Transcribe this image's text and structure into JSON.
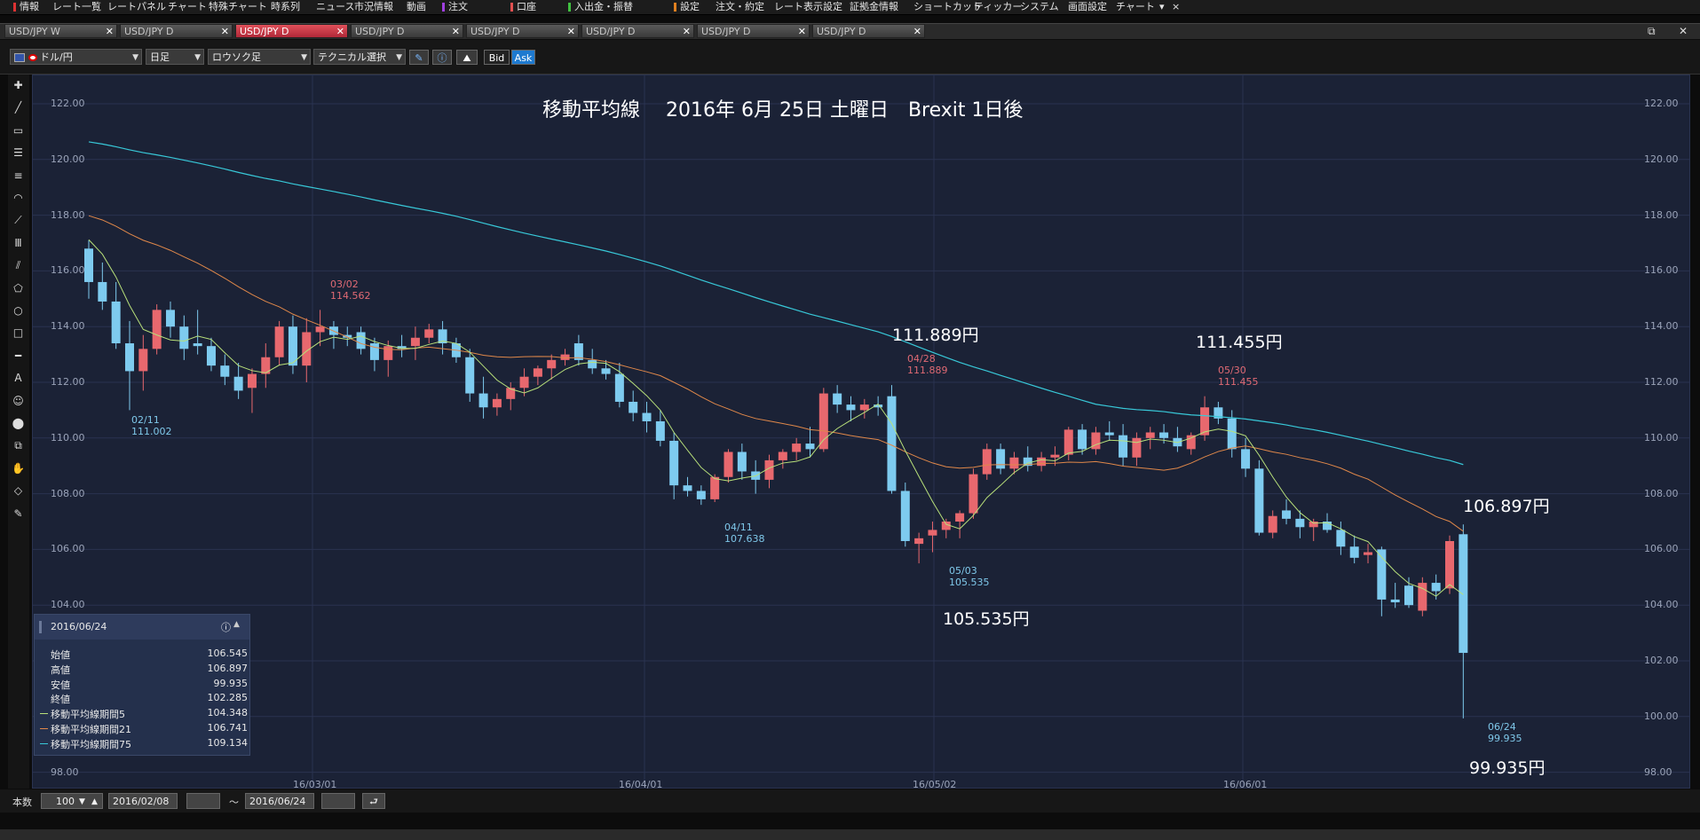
{
  "menubar": {
    "items": [
      {
        "label": "情報",
        "marker": "#d33"
      },
      {
        "label": "レート一覧",
        "marker": ""
      },
      {
        "label": "レートパネル",
        "marker": ""
      },
      {
        "label": "チャート",
        "marker": ""
      },
      {
        "label": "特殊チャート",
        "marker": ""
      },
      {
        "label": "時系列",
        "marker": ""
      },
      {
        "label": "ニュース",
        "marker": ""
      },
      {
        "label": "市況情報",
        "marker": ""
      },
      {
        "label": "動画",
        "marker": ""
      },
      {
        "label": "注文",
        "marker": "#a040e0"
      },
      {
        "label": "口座",
        "marker": "#e05050"
      },
      {
        "label": "入出金・振替",
        "marker": "#40c040"
      },
      {
        "label": "設定",
        "marker": "#e08020"
      },
      {
        "label": "注文・約定",
        "marker": ""
      },
      {
        "label": "レート表示設定",
        "marker": ""
      },
      {
        "label": "証拠金情報",
        "marker": ""
      },
      {
        "label": "ショートカット",
        "marker": ""
      },
      {
        "label": "ティッカー",
        "marker": ""
      },
      {
        "label": "システム",
        "marker": ""
      },
      {
        "label": "画面設定",
        "marker": ""
      },
      {
        "label": "チャート",
        "marker": ""
      }
    ],
    "overflow_arrow": "▾",
    "close": "×"
  },
  "tabs": [
    {
      "label": "USD/JPY W",
      "active": false
    },
    {
      "label": "USD/JPY D",
      "active": false
    },
    {
      "label": "USD/JPY D",
      "active": true
    },
    {
      "label": "USD/JPY D",
      "active": false
    },
    {
      "label": "USD/JPY D",
      "active": false
    },
    {
      "label": "USD/JPY D",
      "active": false
    },
    {
      "label": "USD/JPY D",
      "active": false
    },
    {
      "label": "USD/JPY D",
      "active": false
    }
  ],
  "toolbar": {
    "currency": "ドル/円",
    "period": "日足",
    "chart_type": "ロウソク足",
    "technical": "テクニカル選択",
    "bid": "Bid",
    "ask": "Ask"
  },
  "left_tools": [
    "crosshair-icon",
    "line-icon",
    "ruler-icon",
    "hline-icon",
    "multi-hline-icon",
    "fan-icon",
    "gann-icon",
    "vlines-icon",
    "pitchfork-icon",
    "pentagon-icon",
    "circle-icon",
    "rect-icon",
    "hline-bold-icon",
    "text-icon",
    "icon-tool-icon",
    "paint-icon",
    "copy-icon",
    "hand-icon",
    "eraser-icon",
    "pen-icon"
  ],
  "chart": {
    "title": "移動平均線　 2016年 6月 25日 土曜日　Brexit 1日後",
    "y_ticks": [
      "122.00",
      "120.00",
      "118.00",
      "116.00",
      "114.00",
      "112.00",
      "110.00",
      "108.00",
      "106.00",
      "104.00",
      "102.00",
      "100.00",
      "98.00"
    ],
    "x_ticks": [
      "16/03/01",
      "16/04/01",
      "16/05/02",
      "16/06/01"
    ],
    "big_annotations": [
      "111.889円",
      "111.455円",
      "106.897円",
      "105.535円",
      "99.935円"
    ],
    "marks": [
      {
        "date": "03/02",
        "value": "114.562",
        "color": "red"
      },
      {
        "date": "02/11",
        "value": "111.002",
        "color": "blue"
      },
      {
        "date": "04/28",
        "value": "111.889",
        "color": "red"
      },
      {
        "date": "04/11",
        "value": "107.638",
        "color": "blue"
      },
      {
        "date": "05/03",
        "value": "105.535",
        "color": "blue"
      },
      {
        "date": "05/30",
        "value": "111.455",
        "color": "red"
      },
      {
        "date": "06/24",
        "value": "99.935",
        "color": "blue"
      }
    ],
    "colors": {
      "bg": "#1b2236",
      "up": "#e8686e",
      "down": "#7ecbef",
      "ma5": "#b8e07a",
      "ma21": "#e0884a",
      "ma75": "#38c8d8",
      "grid": "#2a3350"
    }
  },
  "info_panel": {
    "date": "2016/06/24",
    "rows": [
      {
        "label": "始値",
        "value": "106.545",
        "swatch": ""
      },
      {
        "label": "高値",
        "value": "106.897",
        "swatch": ""
      },
      {
        "label": "安値",
        "value": "99.935",
        "swatch": ""
      },
      {
        "label": "終値",
        "value": "102.285",
        "swatch": ""
      },
      {
        "label": "移動平均線期間5",
        "value": "104.348",
        "swatch": "#b8e07a"
      },
      {
        "label": "移動平均線期間21",
        "value": "106.741",
        "swatch": "#e0884a"
      },
      {
        "label": "移動平均線期間75",
        "value": "109.134",
        "swatch": "#38c8d8"
      }
    ]
  },
  "bottom": {
    "count_label": "本数",
    "count_value": "100",
    "from_date": "2016/02/08",
    "tilde": "～",
    "to_date": "2016/06/24"
  },
  "chart_data": {
    "type": "candlestick",
    "title": "移動平均線 2016年 6月 25日 土曜日 Brexit 1日後",
    "ylim": [
      98,
      122
    ],
    "x_ticks": [
      "16/03/01",
      "16/04/01",
      "16/05/02",
      "16/06/01"
    ],
    "series_names": [
      "移動平均線期間5",
      "移動平均線期間21",
      "移動平均線期間75"
    ],
    "ohlc": [
      [
        116.8,
        117.1,
        115.0,
        115.6
      ],
      [
        115.6,
        116.3,
        114.6,
        114.9
      ],
      [
        114.9,
        115.6,
        113.2,
        113.4
      ],
      [
        113.4,
        114.2,
        111.0,
        112.4
      ],
      [
        112.4,
        113.7,
        111.7,
        113.2
      ],
      [
        113.2,
        114.8,
        113.0,
        114.6
      ],
      [
        114.6,
        114.9,
        113.6,
        114.0
      ],
      [
        114.0,
        114.4,
        112.8,
        113.2
      ],
      [
        113.4,
        114.6,
        113.0,
        113.3
      ],
      [
        113.3,
        113.6,
        112.4,
        112.6
      ],
      [
        112.6,
        113.0,
        111.9,
        112.2
      ],
      [
        112.2,
        112.7,
        111.4,
        111.7
      ],
      [
        111.8,
        112.5,
        110.9,
        112.3
      ],
      [
        112.3,
        113.4,
        111.8,
        112.9
      ],
      [
        112.9,
        114.2,
        112.6,
        114.0
      ],
      [
        114.0,
        114.4,
        112.3,
        112.6
      ],
      [
        112.6,
        114.3,
        112.0,
        113.8
      ],
      [
        113.8,
        114.6,
        113.3,
        114.0
      ],
      [
        114.0,
        114.2,
        113.2,
        113.7
      ],
      [
        113.7,
        114.0,
        113.3,
        113.6
      ],
      [
        113.8,
        114.0,
        113.0,
        113.2
      ],
      [
        113.4,
        113.6,
        112.4,
        112.8
      ],
      [
        112.8,
        113.5,
        112.2,
        113.3
      ],
      [
        113.3,
        113.7,
        112.9,
        113.2
      ],
      [
        113.3,
        114.0,
        112.8,
        113.6
      ],
      [
        113.6,
        114.1,
        113.4,
        113.9
      ],
      [
        113.9,
        114.2,
        113.0,
        113.4
      ],
      [
        113.4,
        113.6,
        112.7,
        112.9
      ],
      [
        112.9,
        113.2,
        111.3,
        111.6
      ],
      [
        111.6,
        112.2,
        110.7,
        111.1
      ],
      [
        111.1,
        111.6,
        110.8,
        111.4
      ],
      [
        111.4,
        112.0,
        111.0,
        111.8
      ],
      [
        111.8,
        112.5,
        111.5,
        112.2
      ],
      [
        112.2,
        112.6,
        111.9,
        112.5
      ],
      [
        112.5,
        113.0,
        112.1,
        112.8
      ],
      [
        112.8,
        113.2,
        112.6,
        113.0
      ],
      [
        113.4,
        113.7,
        112.6,
        112.8
      ],
      [
        112.8,
        113.2,
        112.3,
        112.5
      ],
      [
        112.5,
        112.8,
        112.1,
        112.3
      ],
      [
        112.3,
        112.7,
        111.1,
        111.3
      ],
      [
        111.3,
        111.7,
        110.6,
        110.9
      ],
      [
        110.9,
        111.3,
        110.2,
        110.6
      ],
      [
        110.6,
        111.0,
        109.7,
        109.9
      ],
      [
        109.9,
        110.2,
        107.8,
        108.3
      ],
      [
        108.3,
        108.6,
        107.9,
        108.1
      ],
      [
        108.1,
        108.3,
        107.6,
        107.8
      ],
      [
        107.8,
        108.7,
        107.7,
        108.6
      ],
      [
        108.6,
        109.6,
        108.4,
        109.5
      ],
      [
        109.5,
        109.8,
        108.5,
        108.8
      ],
      [
        108.8,
        109.2,
        108.0,
        108.5
      ],
      [
        108.5,
        109.4,
        108.2,
        109.2
      ],
      [
        109.2,
        109.6,
        108.9,
        109.5
      ],
      [
        109.5,
        110.0,
        109.2,
        109.8
      ],
      [
        109.8,
        110.4,
        109.3,
        109.6
      ],
      [
        109.6,
        111.8,
        109.5,
        111.6
      ],
      [
        111.6,
        111.9,
        110.9,
        111.2
      ],
      [
        111.2,
        111.5,
        110.6,
        111.0
      ],
      [
        111.0,
        111.4,
        110.7,
        111.2
      ],
      [
        111.2,
        111.5,
        110.8,
        111.1
      ],
      [
        111.5,
        111.9,
        108.0,
        108.1
      ],
      [
        108.1,
        108.4,
        106.1,
        106.3
      ],
      [
        106.2,
        106.6,
        105.5,
        106.4
      ],
      [
        106.5,
        107.0,
        105.9,
        106.7
      ],
      [
        106.7,
        107.1,
        106.4,
        107.0
      ],
      [
        107.0,
        107.4,
        106.4,
        107.3
      ],
      [
        107.3,
        108.9,
        107.1,
        108.7
      ],
      [
        108.7,
        109.8,
        108.5,
        109.6
      ],
      [
        109.6,
        109.8,
        108.7,
        108.9
      ],
      [
        108.9,
        109.5,
        108.7,
        109.3
      ],
      [
        109.3,
        109.7,
        108.8,
        109.0
      ],
      [
        109.0,
        109.5,
        108.8,
        109.3
      ],
      [
        109.3,
        109.7,
        109.0,
        109.4
      ],
      [
        109.4,
        110.4,
        109.2,
        110.3
      ],
      [
        110.3,
        110.5,
        109.4,
        109.6
      ],
      [
        109.6,
        110.4,
        109.4,
        110.2
      ],
      [
        110.2,
        110.6,
        109.9,
        110.1
      ],
      [
        110.1,
        110.5,
        109.0,
        109.3
      ],
      [
        109.3,
        110.2,
        109.0,
        110.0
      ],
      [
        110.0,
        110.4,
        109.6,
        110.2
      ],
      [
        110.2,
        110.5,
        109.8,
        110.0
      ],
      [
        110.0,
        110.4,
        109.5,
        109.7
      ],
      [
        109.6,
        110.2,
        109.4,
        110.1
      ],
      [
        110.1,
        111.5,
        109.9,
        111.1
      ],
      [
        111.1,
        111.3,
        110.5,
        110.7
      ],
      [
        110.7,
        111.0,
        109.3,
        109.6
      ],
      [
        109.6,
        110.0,
        108.6,
        108.9
      ],
      [
        108.9,
        109.2,
        106.5,
        106.6
      ],
      [
        106.6,
        107.4,
        106.4,
        107.2
      ],
      [
        107.4,
        107.8,
        106.9,
        107.1
      ],
      [
        107.1,
        107.4,
        106.4,
        106.8
      ],
      [
        106.8,
        107.1,
        106.3,
        107.0
      ],
      [
        107.0,
        107.3,
        106.6,
        106.7
      ],
      [
        106.7,
        107.0,
        105.8,
        106.1
      ],
      [
        106.1,
        106.5,
        105.5,
        105.7
      ],
      [
        105.8,
        106.2,
        105.5,
        105.9
      ],
      [
        106.0,
        106.1,
        103.6,
        104.2
      ],
      [
        104.2,
        104.8,
        103.9,
        104.1
      ],
      [
        104.7,
        105.0,
        103.9,
        104.0
      ],
      [
        103.8,
        105.0,
        103.6,
        104.8
      ],
      [
        104.8,
        105.1,
        104.2,
        104.5
      ],
      [
        104.6,
        106.5,
        104.4,
        106.3
      ],
      [
        106.545,
        106.897,
        99.935,
        102.285
      ]
    ],
    "ma5_endpoints": {
      "start": 117.5,
      "end": 104.348
    },
    "ma21_endpoints": {
      "start": 118.1,
      "end": 106.741
    },
    "ma75_endpoints": {
      "start": 120.7,
      "end": 109.134
    }
  }
}
